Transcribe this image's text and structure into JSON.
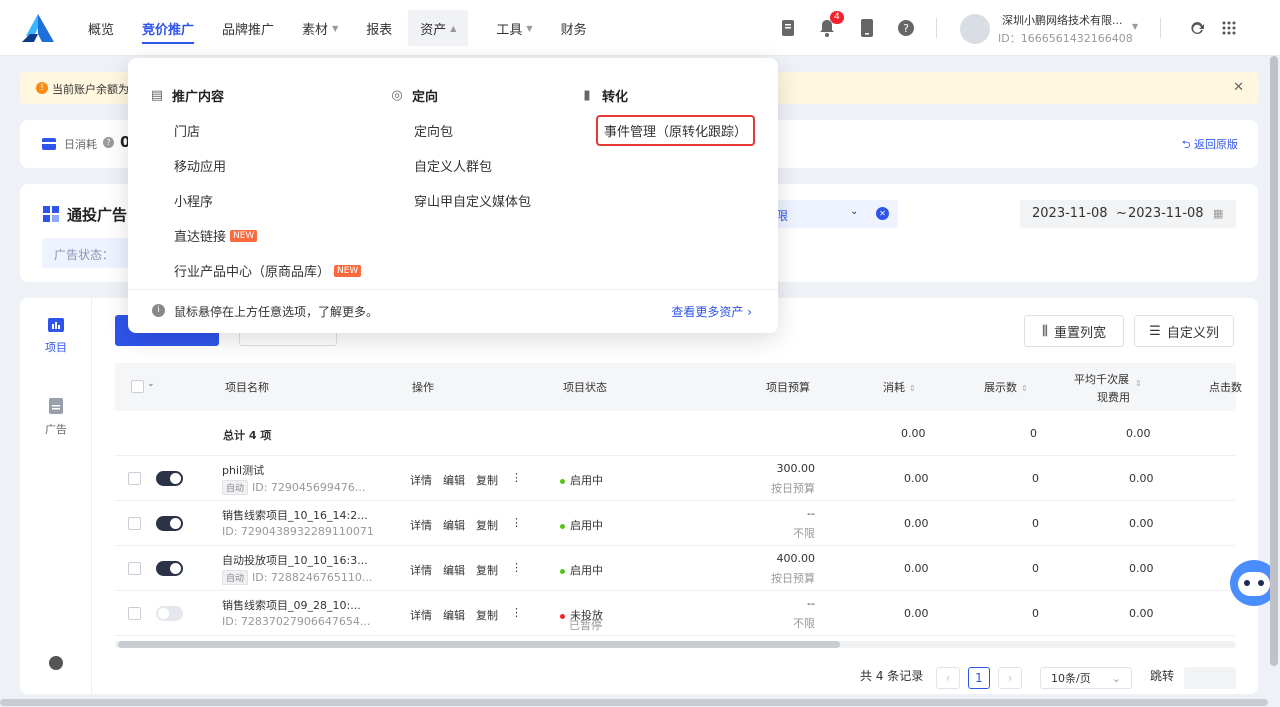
{
  "topnav": {
    "items": [
      "概览",
      "竞价推广",
      "品牌推广",
      "素材",
      "报表",
      "资产",
      "工具",
      "财务"
    ],
    "active": "竞价推广",
    "open": "资产"
  },
  "header": {
    "notification_count": "4",
    "account_name": "深圳小鹏网络技术有限...",
    "account_id": "ID：1666561432166408"
  },
  "notice": {
    "text": "当前账户余额为"
  },
  "stats": {
    "daily_cost_label": "日消耗",
    "daily_cost_value": "0",
    "return_link": "返回原版"
  },
  "filter": {
    "section_title": "通投广告",
    "status_label": "广告状态：",
    "partial_select": "限",
    "date_start": "2023-11-08",
    "date_sep": "~",
    "date_end": "2023-11-08"
  },
  "dropdown": {
    "col1_title": "推广内容",
    "col1_items": [
      "门店",
      "移动应用",
      "小程序",
      "直达链接",
      "行业产品中心（原商品库）"
    ],
    "col1_new_flags": [
      false,
      false,
      false,
      true,
      true
    ],
    "col2_title": "定向",
    "col2_items": [
      "定向包",
      "自定义人群包",
      "穿山甲自定义媒体包"
    ],
    "col3_title": "转化",
    "col3_items": [
      "事件管理（原转化跟踪）"
    ],
    "new_tag": "NEW",
    "footer_hint": "鼠标悬停在上方任意选项，了解更多。",
    "footer_link": "查看更多资产"
  },
  "sidebar": {
    "items": [
      "项目",
      "广告"
    ]
  },
  "toolbar": {
    "reset_width": "重置列宽",
    "custom_columns": "自定义列"
  },
  "table": {
    "headers": [
      "项目名称",
      "操作",
      "项目状态",
      "项目预算",
      "消耗",
      "展示数",
      "平均千次展",
      "现费用",
      "点击数"
    ],
    "total_label": "总计 4 项",
    "total_cost": "0.00",
    "total_impressions": "0",
    "total_cpm": "0.00",
    "actions": [
      "详情",
      "编辑",
      "复制"
    ],
    "rows": [
      {
        "name": "phil测试",
        "auto": true,
        "id": "ID: 729045699476...",
        "status": "启用中",
        "status_color": "#52c41a",
        "sub_status": "",
        "budget": "300.00",
        "budget_type": "按日预算",
        "cost": "0.00",
        "impressions": "0",
        "cpm": "0.00",
        "on": true
      },
      {
        "name": "销售线索项目_10_16_14:2...",
        "auto": false,
        "id": "ID: 7290438932289110071",
        "status": "启用中",
        "status_color": "#52c41a",
        "sub_status": "",
        "budget": "--",
        "budget_type": "不限",
        "cost": "0.00",
        "impressions": "0",
        "cpm": "0.00",
        "on": true
      },
      {
        "name": "自动投放项目_10_10_16:3...",
        "auto": true,
        "id": "ID: 7288246765110...",
        "status": "启用中",
        "status_color": "#52c41a",
        "sub_status": "",
        "budget": "400.00",
        "budget_type": "按日预算",
        "cost": "0.00",
        "impressions": "0",
        "cpm": "0.00",
        "on": true
      },
      {
        "name": "销售线索项目_09_28_10:...",
        "auto": false,
        "id": "ID: 72837027906647654...",
        "status": "未投放",
        "status_color": "#f5222d",
        "sub_status": "已暂停",
        "budget": "--",
        "budget_type": "不限",
        "cost": "0.00",
        "impressions": "0",
        "cpm": "0.00",
        "on": false
      }
    ],
    "auto_tag": "自动"
  },
  "pagination": {
    "total": "共 4 条记录",
    "current": "1",
    "page_size": "10条/页",
    "jump_label": "跳转"
  },
  "colors": {
    "accent": "#2f54eb",
    "highlight": "#e53935",
    "new_tag": "#fa6a3c"
  }
}
